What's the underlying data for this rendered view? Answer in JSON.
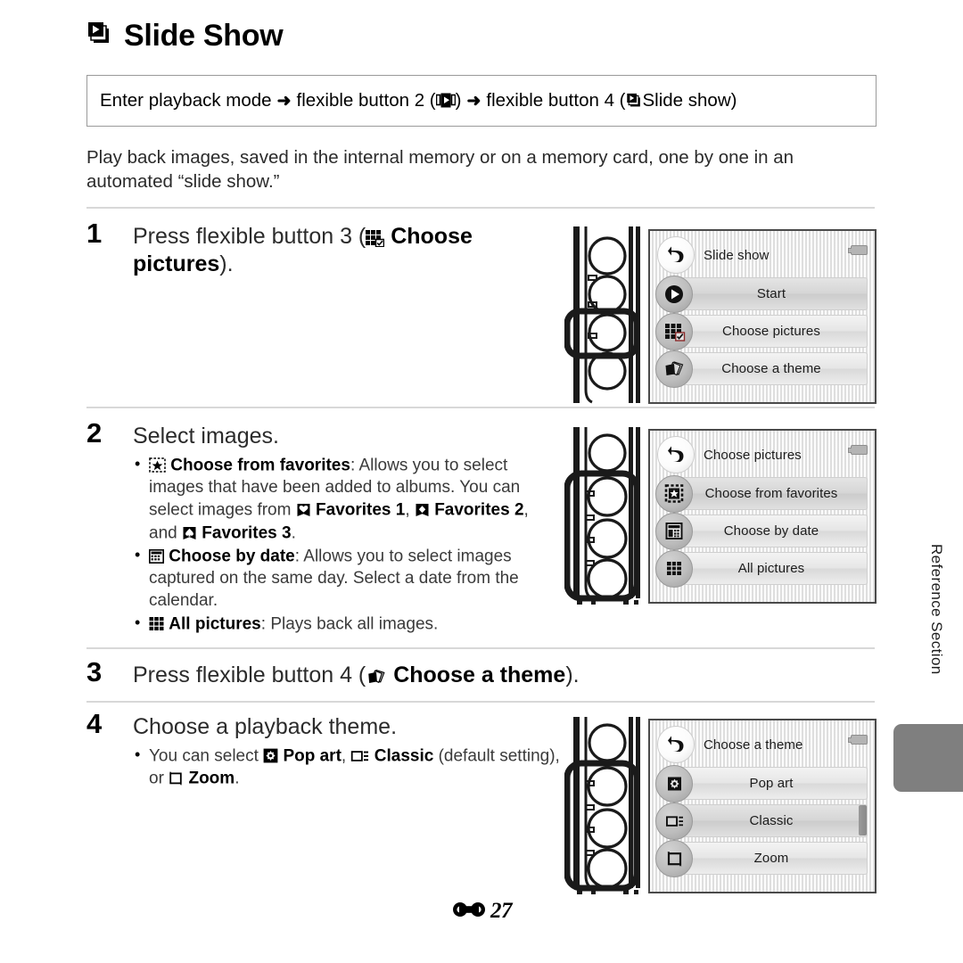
{
  "page": {
    "title": "Slide Show",
    "title_icon": "slide-show-icon",
    "footer_page_number": "27",
    "footer_section_symbol": "reference-section-symbol",
    "side_tab_label": "Reference Section"
  },
  "breadcrumb": {
    "part1": "Enter playback mode",
    "arrow": "➜",
    "part2": "flexible button 2 (",
    "icon2": "playback-menu-icon",
    "part3": ")",
    "part4": "flexible button 4 (",
    "icon4": "slide-show-icon",
    "part5": " Slide show)"
  },
  "intro": "Play back images, saved in the internal memory or on a memory card, one by one in an automated “slide show.”",
  "steps": [
    {
      "number": "1",
      "head_pre": "Press flexible button 3 (",
      "head_icon": "choose-pictures-icon",
      "head_bold": "Choose pictures",
      "head_post": ").",
      "bullets": []
    },
    {
      "number": "2",
      "head_pre": "Select images.",
      "bullets": [
        {
          "icon": "choose-from-favorites-icon",
          "bold": "Choose from favorites",
          "text": ": Allows you to select images that have been added to albums. You can select images from ",
          "inline": [
            {
              "icon": "favorites-1-heart-icon",
              "bold": "Favorites 1"
            },
            {
              "icon": "favorites-2-diamond-icon",
              "bold": "Favorites 2"
            },
            {
              "icon": "favorites-3-spade-icon",
              "bold": "Favorites 3"
            }
          ]
        },
        {
          "icon": "choose-by-date-icon",
          "bold": "Choose by date",
          "text": ": Allows you to select images captured on the same day. Select a date from the calendar."
        },
        {
          "icon": "all-pictures-icon",
          "bold": "All pictures",
          "text": ": Plays back all images."
        }
      ]
    },
    {
      "number": "3",
      "head_pre": "Press flexible button 4 (",
      "head_icon": "choose-a-theme-icon",
      "head_bold": "Choose a theme",
      "head_post": ").",
      "bullets": []
    },
    {
      "number": "4",
      "head_pre": "Choose a playback theme.",
      "bullets": [
        {
          "text_pre": "You can select ",
          "opt1_icon": "pop-art-icon",
          "opt1": "Pop art",
          "sep1": ", ",
          "opt2_icon": "classic-icon",
          "opt2": "Classic",
          "sep2": " (default setting), or ",
          "opt3_icon": "zoom-icon",
          "opt3": "Zoom",
          "text_post": "."
        }
      ]
    }
  ],
  "screens": [
    {
      "id": "slide-show-screen",
      "title": "Slide show",
      "highlighted_button": 3,
      "highlight_span": [
        3,
        3
      ],
      "rows": [
        {
          "icon": "play-start-icon",
          "label": "Start",
          "selected": true,
          "scrollbar": false
        },
        {
          "icon": "choose-pictures-icon",
          "label": "Choose pictures",
          "selected": false,
          "scrollbar": false
        },
        {
          "icon": "choose-a-theme-icon",
          "label": "Choose a theme",
          "selected": false,
          "scrollbar": false
        }
      ]
    },
    {
      "id": "choose-pictures-screen",
      "title": "Choose pictures",
      "highlight_span": [
        2,
        4
      ],
      "rows": [
        {
          "icon": "choose-from-favorites-icon",
          "label": "Choose from favorites",
          "selected": true,
          "scrollbar": false
        },
        {
          "icon": "choose-by-date-icon",
          "label": "Choose by date",
          "selected": false,
          "scrollbar": false
        },
        {
          "icon": "all-pictures-icon",
          "label": "All pictures",
          "selected": false,
          "scrollbar": false
        }
      ]
    },
    {
      "id": "choose-a-theme-screen",
      "title": "Choose a theme",
      "highlight_span": [
        2,
        4
      ],
      "rows": [
        {
          "icon": "pop-art-icon",
          "label": "Pop art",
          "selected": false,
          "scrollbar": false
        },
        {
          "icon": "classic-icon",
          "label": "Classic",
          "selected": true,
          "scrollbar": true
        },
        {
          "icon": "zoom-icon",
          "label": "Zoom",
          "selected": false,
          "scrollbar": false
        }
      ]
    }
  ],
  "colors": {
    "text": "#231f20",
    "rule": "#d8d8d8",
    "lcd_border": "#4a4a4a",
    "side_tab": "#7f7f7f"
  }
}
